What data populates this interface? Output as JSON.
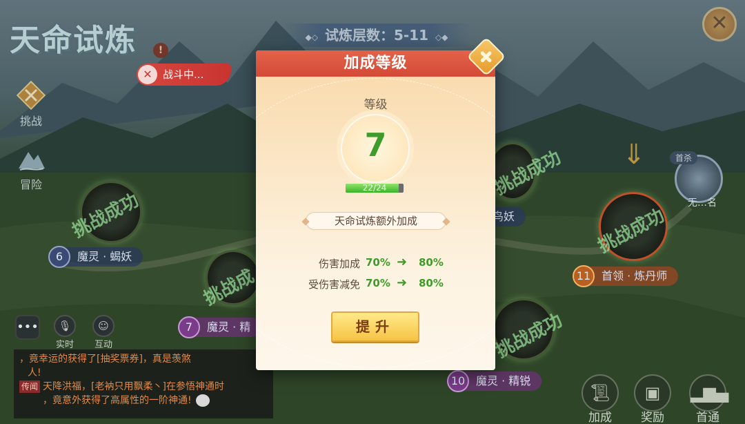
{
  "game": {
    "title": "天命试炼",
    "warning_mark": "!",
    "battle_status": "战斗中...",
    "floor_label": "试炼层数：5-11"
  },
  "side_menu": [
    {
      "label": "挑战",
      "icon": "crossed-swords-icon"
    },
    {
      "label": "冒险",
      "icon": "mountain-icon"
    }
  ],
  "nodes": [
    {
      "num": "6",
      "name": "魔灵 · 蝎妖",
      "stamp": "挑战成功",
      "style": "blue"
    },
    {
      "num": "7",
      "name": "魔灵 · 精",
      "stamp": "挑战成",
      "style": "purple"
    },
    {
      "num": "",
      "name": "鸟妖",
      "stamp": "挑战成功",
      "style": "blue"
    },
    {
      "num": "11",
      "name": "首领 · 炼丹师",
      "stamp": "挑战成功",
      "style": "orange"
    },
    {
      "num": "10",
      "name": "魔灵 · 精锐",
      "stamp": "挑战成功",
      "style": "purple"
    }
  ],
  "first_kill": {
    "badge": "首杀",
    "name": "无…名"
  },
  "chat": {
    "buttons": [
      {
        "label": "",
        "icon": "chat-icon"
      },
      {
        "label": "实时",
        "icon": "microphone-icon"
      },
      {
        "label": "互动",
        "icon": "smiley-icon"
      }
    ],
    "messages": [
      {
        "tag": "",
        "text": "，竟幸运的获得了[抽奖票券]，真是羡煞"
      },
      {
        "tag": "",
        "text": "人!"
      },
      {
        "tag": "传闻",
        "text": "天降洪福，[老衲只用飘柔丶]在参悟神通时"
      },
      {
        "tag": "",
        "text": "，竟意外获得了高属性的一阶神通!"
      }
    ]
  },
  "bottom_buttons": [
    {
      "label": "加成",
      "icon": "scroll-icon"
    },
    {
      "label": "奖励",
      "icon": "chest-icon"
    },
    {
      "label": "首通",
      "icon": "podium-icon"
    }
  ],
  "modal": {
    "title": "加成等级",
    "level_label": "等级",
    "level": "7",
    "xp_current": 22,
    "xp_max": 24,
    "xp_text": "22/24",
    "bonus_title": "天命试炼额外加成",
    "stats": [
      {
        "name": "伤害加成",
        "from": "70%",
        "to": "80%"
      },
      {
        "name": "受伤害减免",
        "from": "70%",
        "to": "80%"
      }
    ],
    "upgrade_label": "提升"
  },
  "colors": {
    "header_red": "#d34a36",
    "value_green": "#3f9c2a",
    "button_gold": "#f6c445"
  }
}
